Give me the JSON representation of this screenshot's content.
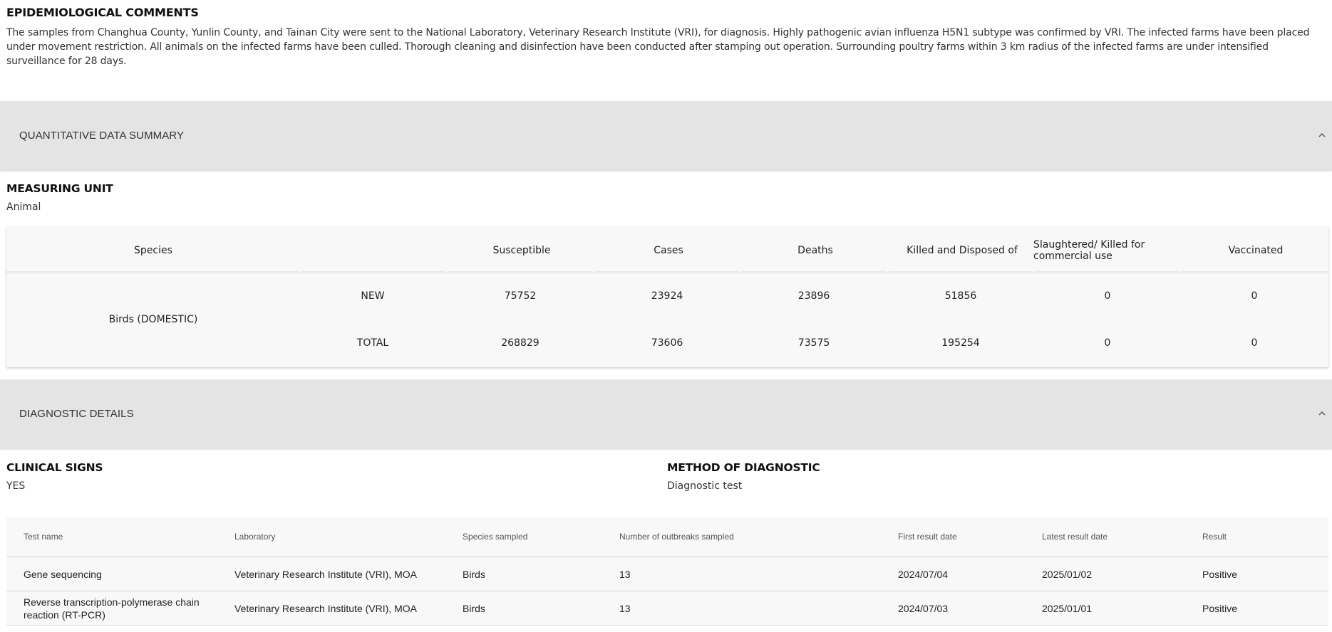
{
  "epidemiological": {
    "heading": "EPIDEMIOLOGICAL COMMENTS",
    "text": "The samples from Changhua County, Yunlin County, and Tainan City were sent to the National Laboratory, Veterinary Research Institute (VRI), for diagnosis. Highly pathogenic avian influenza H5N1 subtype was confirmed by VRI. The infected farms have been placed under movement restriction. All animals on the infected farms have been culled. Thorough cleaning and disinfection have been conducted after stamping out operation. Surrounding poultry farms within 3 km radius of the infected farms are under intensified surveillance for 28 days."
  },
  "quantitative_section": {
    "title": "QUANTITATIVE DATA SUMMARY",
    "toggle_icon": "chevron-up-icon"
  },
  "measuring_unit": {
    "heading": "MEASURING UNIT",
    "value": "Animal"
  },
  "quant_table": {
    "headers": {
      "species": "Species",
      "susceptible": "Susceptible",
      "cases": "Cases",
      "deaths": "Deaths",
      "killed": "Killed and Disposed of",
      "slaughtered": "Slaughtered/ Killed for commercial use",
      "vaccinated": "Vaccinated"
    },
    "species_name": "Birds (DOMESTIC)",
    "rows": [
      {
        "label": "NEW",
        "susceptible": "75752",
        "cases": "23924",
        "deaths": "23896",
        "killed": "51856",
        "slaughtered": "0",
        "vaccinated": "0"
      },
      {
        "label": "TOTAL",
        "susceptible": "268829",
        "cases": "73606",
        "deaths": "73575",
        "killed": "195254",
        "slaughtered": "0",
        "vaccinated": "0"
      }
    ]
  },
  "diagnostic_section": {
    "title": "DIAGNOSTIC DETAILS",
    "toggle_icon": "chevron-up-icon"
  },
  "clinical_signs": {
    "heading": "CLINICAL SIGNS",
    "value": "YES"
  },
  "method_diagnostic": {
    "heading": "METHOD OF DIAGNOSTIC",
    "value": "Diagnostic test"
  },
  "diag_table": {
    "headers": {
      "test_name": "Test name",
      "laboratory": "Laboratory",
      "species": "Species sampled",
      "outbreaks": "Number of outbreaks sampled",
      "first": "First result date",
      "latest": "Latest result date",
      "result": "Result"
    },
    "rows": [
      {
        "test_name": "Gene sequencing",
        "laboratory": "Veterinary Research Institute (VRI), MOA",
        "species": "Birds",
        "outbreaks": "13",
        "first": "2024/07/04",
        "latest": "2025/01/02",
        "result": "Positive"
      },
      {
        "test_name": "Reverse transcription-polymerase chain reaction (RT-PCR)",
        "laboratory": "Veterinary Research Institute (VRI), MOA",
        "species": "Birds",
        "outbreaks": "13",
        "first": "2024/07/03",
        "latest": "2025/01/01",
        "result": "Positive"
      }
    ]
  }
}
